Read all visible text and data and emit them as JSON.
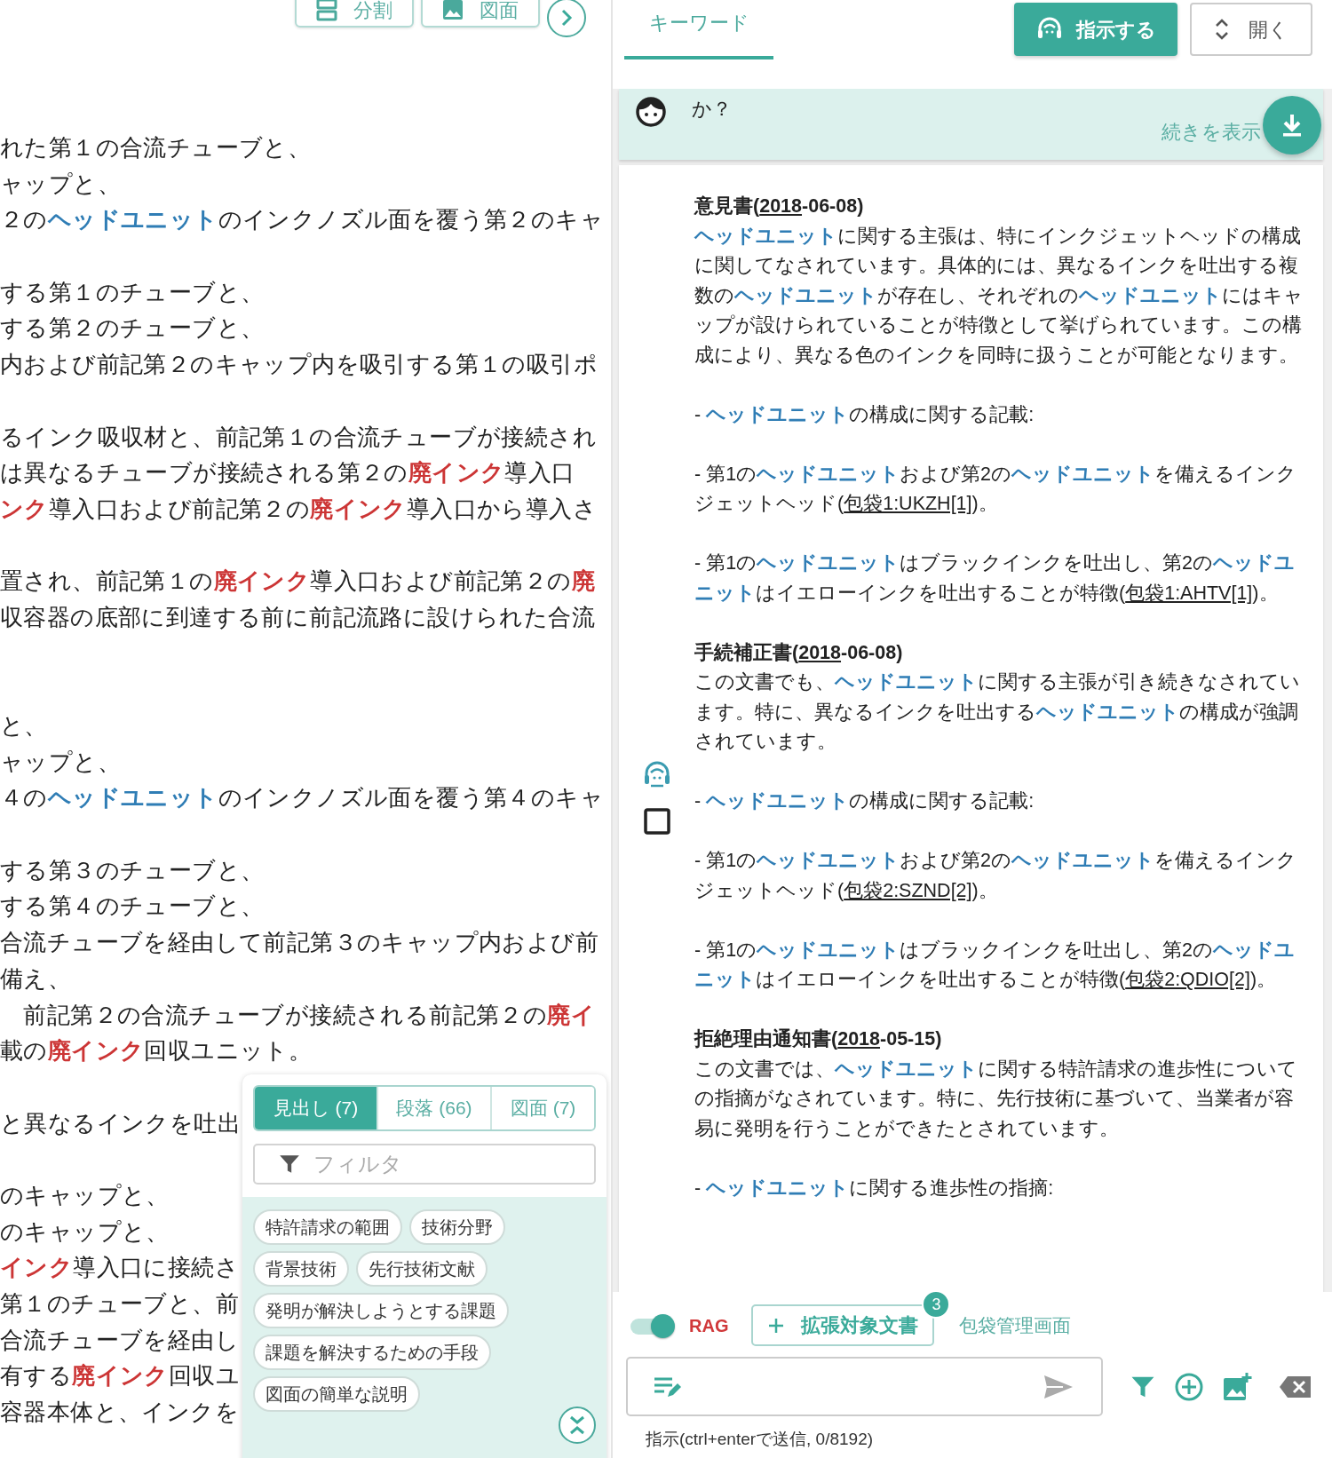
{
  "left_toolbar": {
    "buttons": [
      {
        "label": "分割",
        "kind": "split"
      },
      {
        "label": "図面",
        "kind": "image"
      }
    ]
  },
  "document_lines": [
    {
      "kind": "text",
      "segments": [
        {
          "text": "れた第１の合流チューブと、",
          "kind": "plain"
        }
      ]
    },
    {
      "kind": "text",
      "segments": [
        {
          "text": "ャップと、",
          "kind": "plain"
        }
      ]
    },
    {
      "kind": "text",
      "segments": [
        {
          "text": "２の",
          "kind": "plain"
        },
        {
          "text": "ヘッドユニット",
          "kind": "keyword"
        },
        {
          "text": "のインクノズル面を覆う第２のキャ",
          "kind": "plain"
        }
      ]
    },
    {
      "kind": "blank"
    },
    {
      "kind": "text",
      "segments": [
        {
          "text": "する第１のチューブと、",
          "kind": "plain"
        }
      ]
    },
    {
      "kind": "text",
      "segments": [
        {
          "text": "する第２のチューブと、",
          "kind": "plain"
        }
      ]
    },
    {
      "kind": "text",
      "segments": [
        {
          "text": "内および前記第２のキャップ内を吸引する第１の吸引ポ",
          "kind": "plain"
        }
      ]
    },
    {
      "kind": "blank"
    },
    {
      "kind": "text",
      "segments": [
        {
          "text": "るインク吸収材と、前記第１の合流チューブが接続され",
          "kind": "plain"
        }
      ]
    },
    {
      "kind": "text",
      "segments": [
        {
          "text": "は異なるチューブが接続される第２の",
          "kind": "plain"
        },
        {
          "text": "廃インク",
          "kind": "alert"
        },
        {
          "text": "導入口",
          "kind": "plain"
        }
      ]
    },
    {
      "kind": "text",
      "segments": [
        {
          "text": "ンク",
          "kind": "alert"
        },
        {
          "text": "導入口および前記第２の",
          "kind": "plain"
        },
        {
          "text": "廃インク",
          "kind": "alert"
        },
        {
          "text": "導入口から導入さ",
          "kind": "plain"
        }
      ]
    },
    {
      "kind": "blank"
    },
    {
      "kind": "text",
      "segments": [
        {
          "text": "置され、前記第１の",
          "kind": "plain"
        },
        {
          "text": "廃インク",
          "kind": "alert"
        },
        {
          "text": "導入口および前記第２の",
          "kind": "plain"
        },
        {
          "text": "廃",
          "kind": "alert"
        }
      ]
    },
    {
      "kind": "text",
      "segments": [
        {
          "text": "収容器の底部に到達する前に前記流路に設けられた合流",
          "kind": "plain"
        }
      ]
    },
    {
      "kind": "blank"
    },
    {
      "kind": "blank"
    },
    {
      "kind": "text",
      "segments": [
        {
          "text": "と、",
          "kind": "plain"
        }
      ]
    },
    {
      "kind": "text",
      "segments": [
        {
          "text": "ャップと、",
          "kind": "plain"
        }
      ]
    },
    {
      "kind": "text",
      "segments": [
        {
          "text": "４の",
          "kind": "plain"
        },
        {
          "text": "ヘッドユニット",
          "kind": "keyword"
        },
        {
          "text": "のインクノズル面を覆う第４のキャ",
          "kind": "plain"
        }
      ]
    },
    {
      "kind": "blank"
    },
    {
      "kind": "text",
      "segments": [
        {
          "text": "する第３のチューブと、",
          "kind": "plain"
        }
      ]
    },
    {
      "kind": "text",
      "segments": [
        {
          "text": "する第４のチューブと、",
          "kind": "plain"
        }
      ]
    },
    {
      "kind": "text",
      "segments": [
        {
          "text": "合流チューブを経由して前記第３のキャップ内および前",
          "kind": "plain"
        }
      ]
    },
    {
      "kind": "text",
      "segments": [
        {
          "text": "備え、",
          "kind": "plain"
        }
      ]
    },
    {
      "kind": "text",
      "segments": [
        {
          "text": "　前記第２の合流チューブが接続される前記第２の",
          "kind": "plain"
        },
        {
          "text": "廃イ",
          "kind": "alert"
        }
      ]
    },
    {
      "kind": "text",
      "segments": [
        {
          "text": "載の",
          "kind": "plain"
        },
        {
          "text": "廃インク",
          "kind": "alert"
        },
        {
          "text": "回収ユニット。",
          "kind": "plain"
        }
      ]
    },
    {
      "kind": "blank"
    },
    {
      "kind": "text",
      "segments": [
        {
          "text": "と異なるインクを吐出",
          "kind": "plain"
        }
      ]
    },
    {
      "kind": "blank"
    },
    {
      "kind": "text",
      "segments": [
        {
          "text": "のキャップと、",
          "kind": "plain"
        }
      ]
    },
    {
      "kind": "text",
      "segments": [
        {
          "text": "のキャップと、",
          "kind": "plain"
        }
      ]
    },
    {
      "kind": "text",
      "segments": [
        {
          "text": "インク",
          "kind": "alert"
        },
        {
          "text": "導入口に接続さ",
          "kind": "plain"
        }
      ]
    },
    {
      "kind": "text",
      "segments": [
        {
          "text": "第１のチューブと、前",
          "kind": "plain"
        }
      ]
    },
    {
      "kind": "text",
      "segments": [
        {
          "text": "合流チューブを経由し",
          "kind": "plain"
        }
      ]
    },
    {
      "kind": "text",
      "segments": [
        {
          "text": "有する",
          "kind": "plain"
        },
        {
          "text": "廃インク",
          "kind": "alert"
        },
        {
          "text": "回収ユ",
          "kind": "plain"
        }
      ]
    },
    {
      "kind": "text",
      "segments": [
        {
          "text": "容器本体と、インクを",
          "kind": "plain"
        }
      ]
    }
  ],
  "outline_popup": {
    "tabs": [
      {
        "label": "見出し (7)",
        "selected": true
      },
      {
        "label": "段落 (66)",
        "selected": false
      },
      {
        "label": "図面 (7)",
        "selected": false
      }
    ],
    "filter": {
      "placeholder": "フィルタ"
    },
    "chips": [
      "特許請求の範囲",
      "技術分野",
      "背景技術",
      "先行技術文献",
      "発明が解決しようとする課題",
      "課題を解決するための手段",
      "図面の簡単な説明"
    ]
  },
  "keyword_tab": {
    "label": "キーワード",
    "selected": true
  },
  "header_buttons": {
    "instruct": "指示する",
    "expand": "開く"
  },
  "chat_bubble": {
    "text": "か？",
    "more_link": "続きを表示"
  },
  "answer_sections": [
    {
      "heading": [
        {
          "text": "意見書(",
          "kind": "plain"
        },
        {
          "text": "2018",
          "kind": "link"
        },
        {
          "text": "-06-08)",
          "kind": "plain"
        }
      ],
      "paragraphs": [
        [
          {
            "text": "ヘッドユニット",
            "kind": "keyword"
          },
          {
            "text": "に関する主張は、特にインクジェットヘッドの構成に関してなされています。具体的には、異なるインクを吐出する複数の",
            "kind": "plain"
          },
          {
            "text": "ヘッドユニット",
            "kind": "keyword"
          },
          {
            "text": "が存在し、それぞれの",
            "kind": "plain"
          },
          {
            "text": "ヘッドユニット",
            "kind": "keyword"
          },
          {
            "text": "にはキャップが設けられていることが特徴として挙げられています。この構成により、異なる色のインクを同時に扱うことが可能となります。",
            "kind": "plain"
          }
        ],
        [
          {
            "text": "- ",
            "kind": "plain"
          },
          {
            "text": "ヘッドユニット",
            "kind": "keyword"
          },
          {
            "text": "の構成に関する記載:",
            "kind": "plain"
          }
        ],
        [
          {
            "text": "- 第1の",
            "kind": "plain"
          },
          {
            "text": "ヘッドユニット",
            "kind": "keyword"
          },
          {
            "text": "および第2の",
            "kind": "plain"
          },
          {
            "text": "ヘッドユニット",
            "kind": "keyword"
          },
          {
            "text": "を備えるインクジェットヘッド(",
            "kind": "plain"
          },
          {
            "text": "包袋1:UKZH[1]",
            "kind": "link"
          },
          {
            "text": ")。",
            "kind": "plain"
          }
        ],
        [
          {
            "text": "- 第1の",
            "kind": "plain"
          },
          {
            "text": "ヘッドユニット",
            "kind": "keyword"
          },
          {
            "text": "はブラックインクを吐出し、第2の",
            "kind": "plain"
          },
          {
            "text": "ヘッドユニット",
            "kind": "keyword"
          },
          {
            "text": "はイエローインクを吐出することが特徴(",
            "kind": "plain"
          },
          {
            "text": "包袋1:AHTV[1]",
            "kind": "link"
          },
          {
            "text": ")。",
            "kind": "plain"
          }
        ]
      ]
    },
    {
      "heading": [
        {
          "text": "手続補正書(",
          "kind": "plain"
        },
        {
          "text": "2018",
          "kind": "link"
        },
        {
          "text": "-06-08)",
          "kind": "plain"
        }
      ],
      "paragraphs": [
        [
          {
            "text": "この文書でも、",
            "kind": "plain"
          },
          {
            "text": "ヘッドユニット",
            "kind": "keyword"
          },
          {
            "text": "に関する主張が引き続きなされています。特に、異なるインクを吐出する",
            "kind": "plain"
          },
          {
            "text": "ヘッドユニット",
            "kind": "keyword"
          },
          {
            "text": "の構成が強調されています。",
            "kind": "plain"
          }
        ],
        [
          {
            "text": "- ",
            "kind": "plain"
          },
          {
            "text": "ヘッドユニット",
            "kind": "keyword"
          },
          {
            "text": "の構成に関する記載:",
            "kind": "plain"
          }
        ],
        [
          {
            "text": "- 第1の",
            "kind": "plain"
          },
          {
            "text": "ヘッドユニット",
            "kind": "keyword"
          },
          {
            "text": "および第2の",
            "kind": "plain"
          },
          {
            "text": "ヘッドユニット",
            "kind": "keyword"
          },
          {
            "text": "を備えるインクジェットヘッド(",
            "kind": "plain"
          },
          {
            "text": "包袋2:SZND[2]",
            "kind": "link"
          },
          {
            "text": ")。",
            "kind": "plain"
          }
        ],
        [
          {
            "text": "- 第1の",
            "kind": "plain"
          },
          {
            "text": "ヘッドユニット",
            "kind": "keyword"
          },
          {
            "text": "はブラックインクを吐出し、第2の",
            "kind": "plain"
          },
          {
            "text": "ヘッドユニット",
            "kind": "keyword"
          },
          {
            "text": "はイエローインクを吐出することが特徴(",
            "kind": "plain"
          },
          {
            "text": "包袋2:QDIO[2]",
            "kind": "link"
          },
          {
            "text": ")。",
            "kind": "plain"
          }
        ]
      ]
    },
    {
      "heading": [
        {
          "text": "拒絶理由通知書(",
          "kind": "plain"
        },
        {
          "text": "2018",
          "kind": "link"
        },
        {
          "text": "-05-15)",
          "kind": "plain"
        }
      ],
      "paragraphs": [
        [
          {
            "text": "この文書では、",
            "kind": "plain"
          },
          {
            "text": "ヘッドユニット",
            "kind": "keyword"
          },
          {
            "text": "に関する特許請求の進歩性についての指摘がなされています。特に、先行技術に基づいて、当業者が容易に発明を行うことができたとされています。",
            "kind": "plain"
          }
        ],
        [
          {
            "text": "- ",
            "kind": "plain"
          },
          {
            "text": "ヘッドユニット",
            "kind": "keyword"
          },
          {
            "text": "に関する進歩性の指摘:",
            "kind": "plain"
          }
        ]
      ]
    }
  ],
  "review_checkbox": {
    "checked": false
  },
  "rag": {
    "on": true,
    "label": "RAG"
  },
  "extend_button": {
    "label": "拡張対象文書",
    "badge": "3"
  },
  "bag_link": "包袋管理画面",
  "input": {
    "hint": "指示(ctrl+enterで送信, 0/8192)"
  }
}
